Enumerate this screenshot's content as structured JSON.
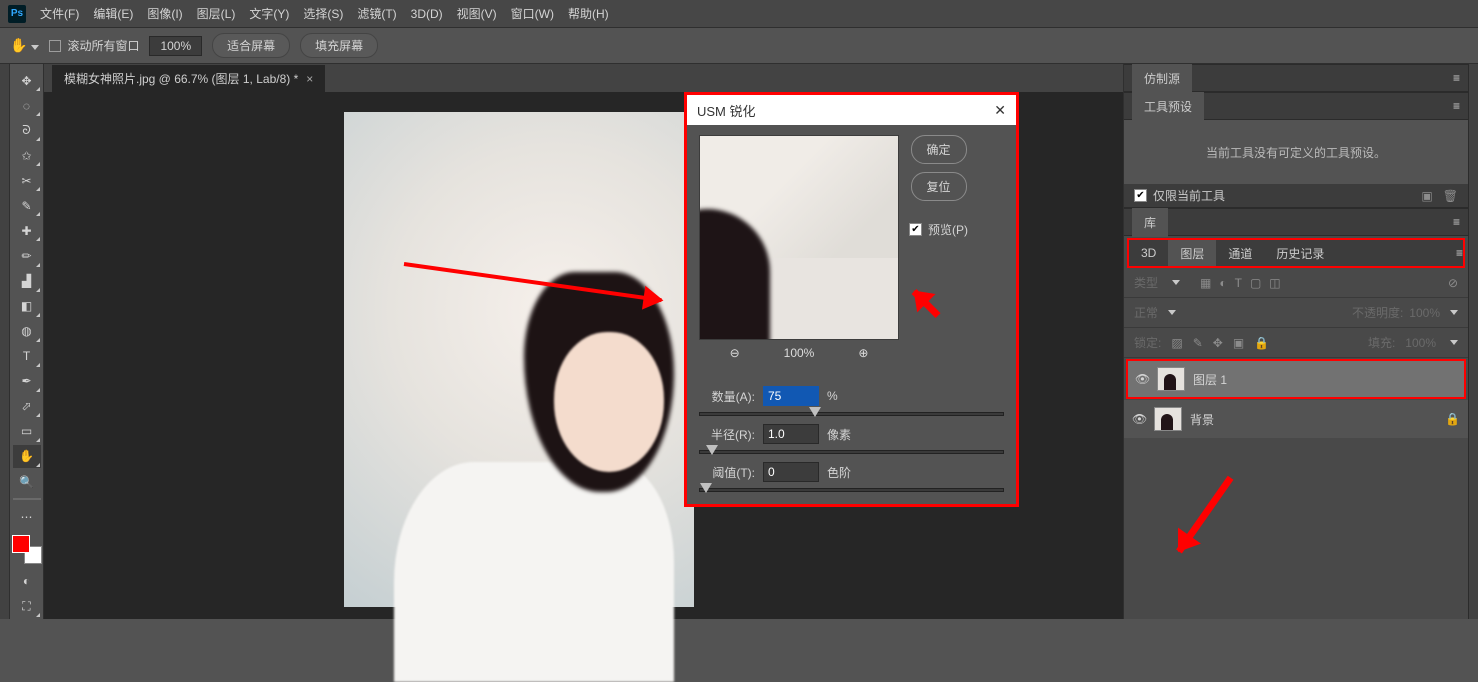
{
  "menu": {
    "items": [
      "文件(F)",
      "编辑(E)",
      "图像(I)",
      "图层(L)",
      "文字(Y)",
      "选择(S)",
      "滤镜(T)",
      "3D(D)",
      "视图(V)",
      "窗口(W)",
      "帮助(H)"
    ]
  },
  "options": {
    "scroll_all": "滚动所有窗口",
    "zoom": "100%",
    "fit_screen": "适合屏幕",
    "fill_screen": "填充屏幕"
  },
  "doc_tab": {
    "title": "模糊女神照片.jpg @ 66.7% (图层 1, Lab/8) *"
  },
  "dialog": {
    "title": "USM 锐化",
    "ok": "确定",
    "reset": "复位",
    "preview_label": "预览(P)",
    "zoom_level": "100%",
    "amount": {
      "label": "数量(A):",
      "value": "75",
      "unit": "%"
    },
    "radius": {
      "label": "半径(R):",
      "value": "1.0",
      "unit": "像素"
    },
    "threshold": {
      "label": "阈值(T):",
      "value": "0",
      "unit": "色阶"
    }
  },
  "panels": {
    "clone_source": "仿制源",
    "tool_presets": "工具预设",
    "tool_presets_msg": "当前工具没有可定义的工具预设。",
    "only_current": "仅限当前工具",
    "library": "库",
    "tabs": {
      "d3": "3D",
      "layers": "图层",
      "channels": "通道",
      "history": "历史记录"
    },
    "layer_opts": {
      "kind": "类型",
      "blend": "正常",
      "opacity_label": "不透明度:",
      "opacity": "100%",
      "lock_label": "锁定:",
      "fill_label": "填充:",
      "fill": "100%"
    },
    "layers": [
      {
        "name": "图层 1",
        "selected": true,
        "locked": false
      },
      {
        "name": "背景",
        "selected": false,
        "locked": true
      }
    ]
  }
}
